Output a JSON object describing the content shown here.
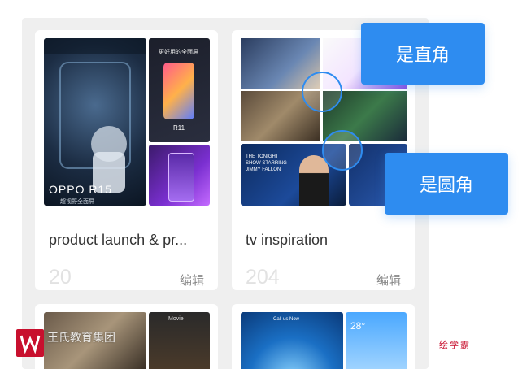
{
  "cards": [
    {
      "title": "product launch & pr...",
      "count": "20",
      "edit_label": "编辑"
    },
    {
      "title": "tv inspiration",
      "count": "204",
      "edit_label": "编辑"
    }
  ],
  "callouts": {
    "top": "是直角",
    "bottom": "是圆角"
  },
  "thumbnails": {
    "oppo_brand": "OPPO R15",
    "oppo_sub": "超视野全面屏",
    "phone_caption": "更好用的全面屏",
    "phone_model": "R11",
    "tv_headline": "THE TONIGHT SHOW STARRING JIMMY FALLON"
  },
  "bottom_cards": {
    "left_app_label": "Movie",
    "right_weather": "28°",
    "right_banner": "Call us Now"
  },
  "watermark": {
    "brand": "王氏教育集团",
    "right_text": "绘学霸"
  },
  "colors": {
    "accent": "#2e8cf0",
    "panel_bg": "#efefef",
    "card_bg": "#ffffff"
  }
}
